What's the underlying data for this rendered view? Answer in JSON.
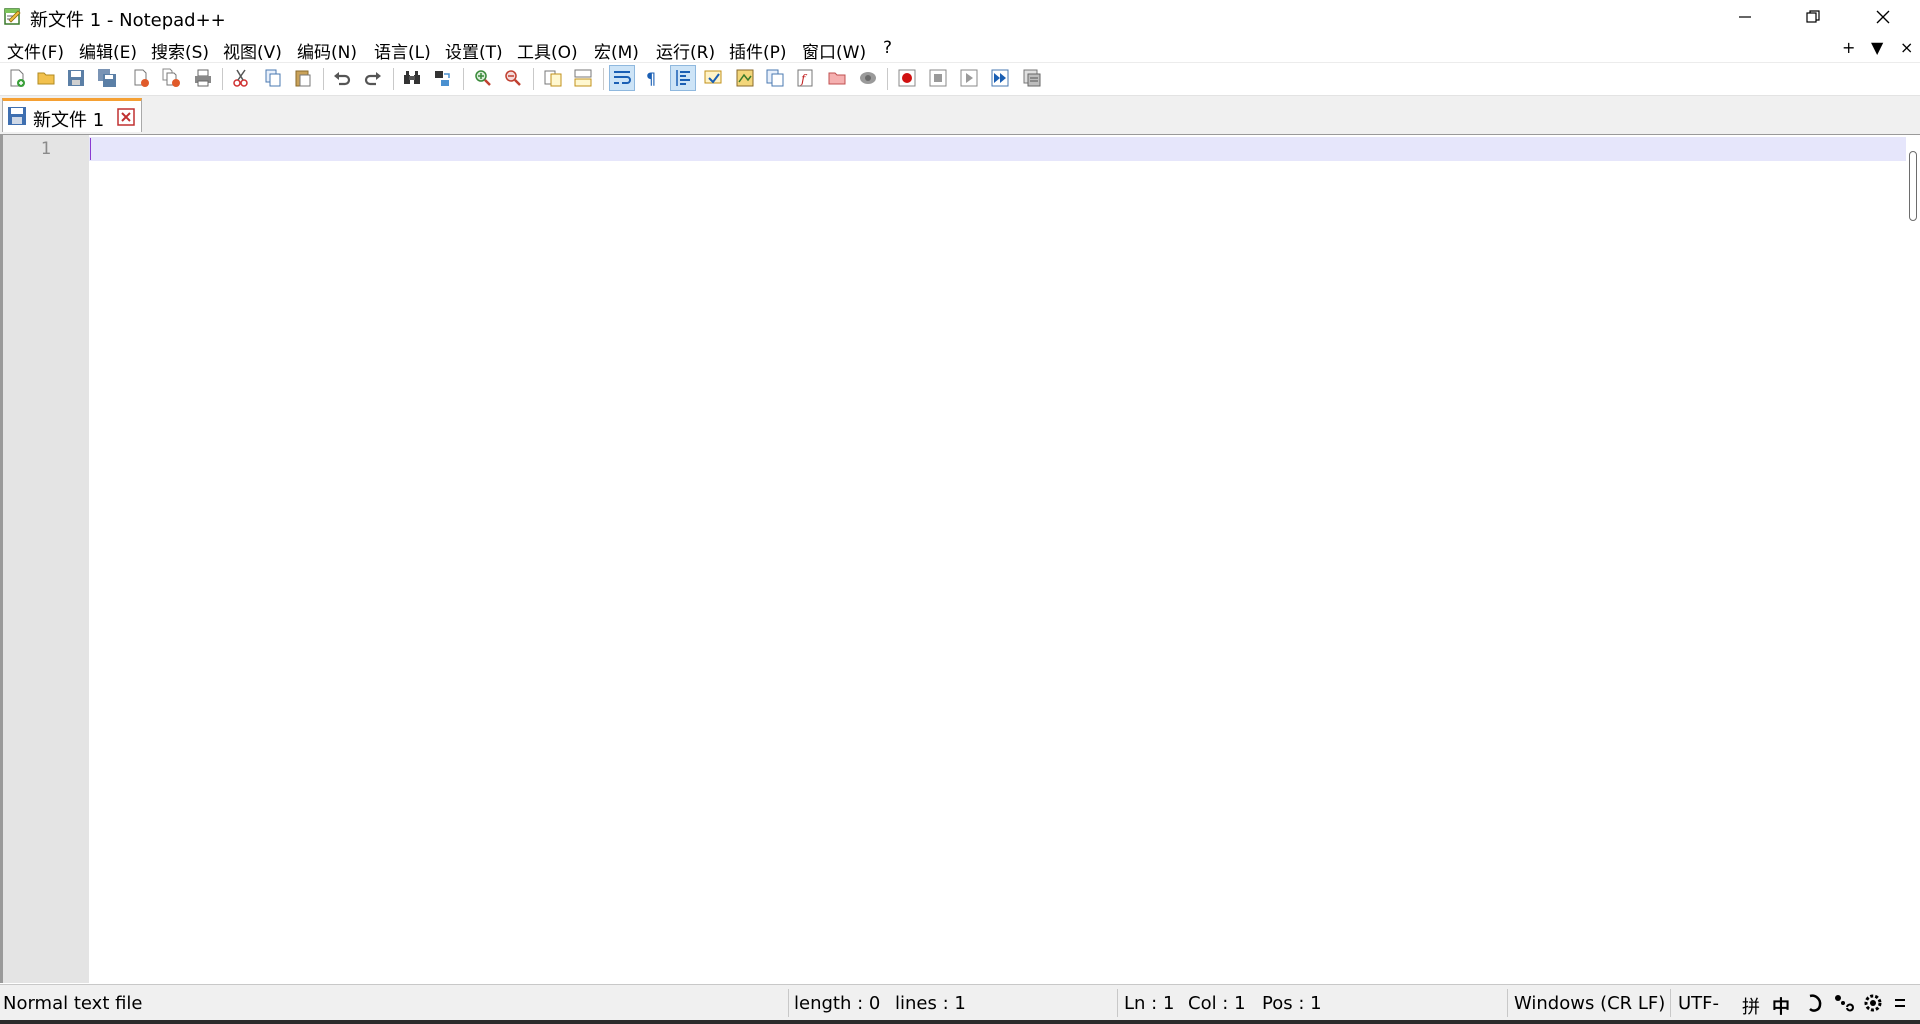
{
  "window": {
    "title": "新文件 1 - Notepad++"
  },
  "menu": {
    "items": [
      "文件(F)",
      "编辑(E)",
      "搜索(S)",
      "视图(V)",
      "编码(N)",
      "语言(L)",
      "设置(T)",
      "工具(O)",
      "宏(M)",
      "运行(R)",
      "插件(P)",
      "窗口(W)",
      "?"
    ],
    "right": [
      "+",
      "▼",
      "×"
    ]
  },
  "tabs": [
    {
      "label": "新文件 1",
      "icon": "save-icon",
      "close_icon": "tab-close-icon"
    }
  ],
  "editor": {
    "line_numbers": [
      "1"
    ],
    "content": ""
  },
  "statusbar": {
    "file_type": "Normal text file",
    "length": "length : 0",
    "lines": "lines : 1",
    "ln": "Ln : 1",
    "col": "Col : 1",
    "pos": "Pos : 1",
    "eol": "Windows (CR LF)",
    "encoding": "UTF-",
    "ime": [
      "拼",
      "中"
    ]
  },
  "colors": {
    "current_line": "#e6e6fb",
    "gutter": "#e4e4e4",
    "tab_accent": "#f5a033",
    "caret": "#8a3ad0"
  }
}
